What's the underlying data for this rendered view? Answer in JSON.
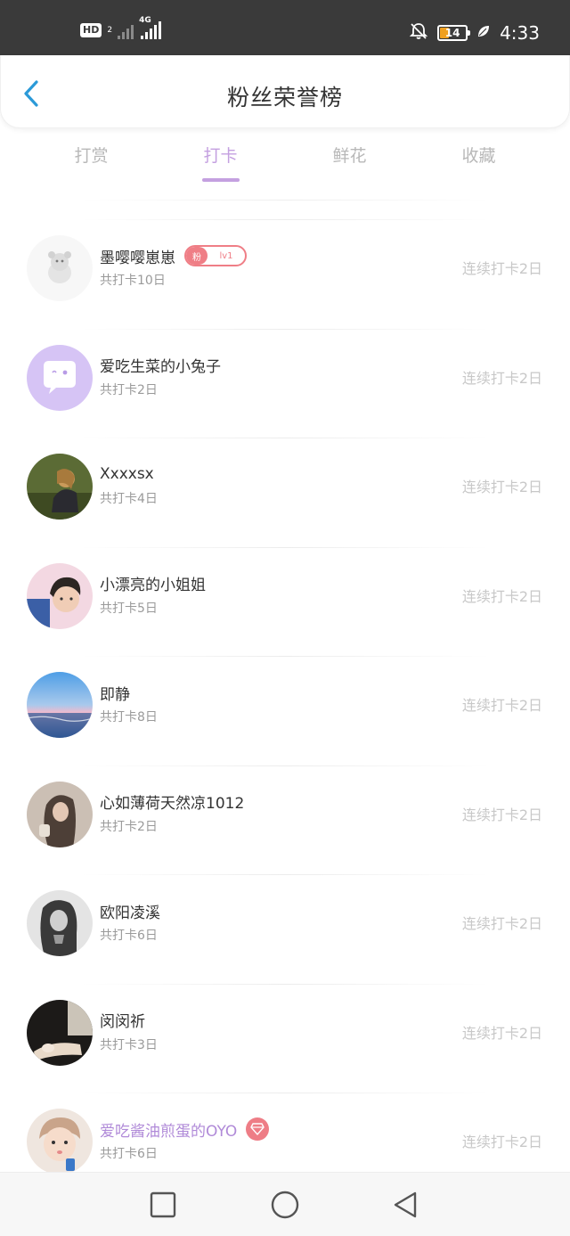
{
  "status_bar": {
    "hd_label": "HD",
    "sim_label": "2",
    "network_label": "4G",
    "battery_level": "14",
    "time": "4:33",
    "icons": [
      "hd-icon",
      "signal-icon",
      "mute-bell-icon",
      "battery-icon",
      "leaf-icon"
    ]
  },
  "header": {
    "title": "粉丝荣誉榜",
    "back_icon": "chevron-left-icon"
  },
  "tabs": [
    {
      "label": "打赏",
      "active": false
    },
    {
      "label": "打卡",
      "active": true
    },
    {
      "label": "鲜花",
      "active": false
    },
    {
      "label": "收藏",
      "active": false
    }
  ],
  "accent_color": "#c4a0e0",
  "users": [
    {
      "name": "墨嘤嘤崽崽",
      "total": "共打卡10日",
      "streak": "连续打卡2日",
      "badge": {
        "fan": "粉",
        "level": "lv1"
      }
    },
    {
      "name": "爱吃生菜的小兔子",
      "total": "共打卡2日",
      "streak": "连续打卡2日"
    },
    {
      "name": "Xxxxsx",
      "total": "共打卡4日",
      "streak": "连续打卡2日"
    },
    {
      "name": "小漂亮的小姐姐",
      "total": "共打卡5日",
      "streak": "连续打卡2日"
    },
    {
      "name": "即静",
      "total": "共打卡8日",
      "streak": "连续打卡2日"
    },
    {
      "name": "心如薄荷天然凉1012",
      "total": "共打卡2日",
      "streak": "连续打卡2日"
    },
    {
      "name": "欧阳凌溪",
      "total": "共打卡6日",
      "streak": "连续打卡2日"
    },
    {
      "name": "闵闵祈",
      "total": "共打卡3日",
      "streak": "连续打卡2日"
    },
    {
      "name": "爱吃酱油煎蛋的OYO",
      "total": "共打卡6日",
      "streak": "连续打卡2日",
      "vip": true
    }
  ],
  "nav_bar": {
    "icons": [
      "recent-apps-square-icon",
      "home-circle-icon",
      "back-triangle-icon"
    ]
  }
}
